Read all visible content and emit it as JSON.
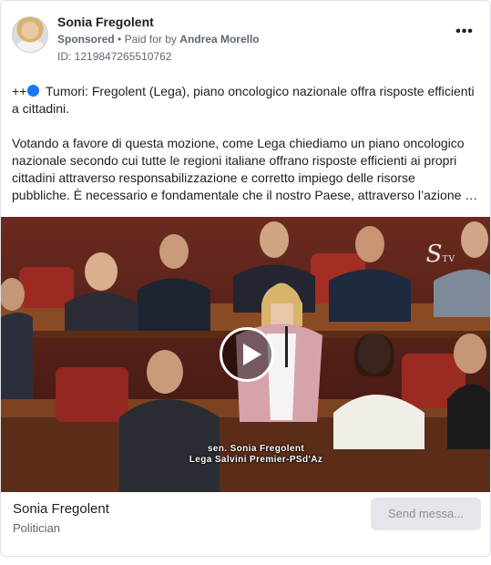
{
  "header": {
    "page_name": "Sonia Fregolent",
    "sponsored_label": "Sponsored",
    "paid_for_prefix": "Paid for by",
    "payer": "Andrea Morello",
    "ad_id": "ID: 1219847265510762",
    "more_icon": "ellipsis-icon"
  },
  "post": {
    "line1_prefix": "++",
    "line1_text": "Tumori: Fregolent (Lega), piano oncologico nazionale offra risposte efficienti a cittadini.",
    "paragraph2_lines": [
      "Votando a favore di questa mozione, come Lega chiediamo un piano oncologico",
      "nazionale secondo cui tutte le regioni italiane offrano risposte efficienti ai propri",
      "cittadini attraverso responsabilizzazione e corretto impiego delle risorse",
      "pubbliche. È necessario e fondamentale che il nostro Paese, attraverso l’azione di…"
    ]
  },
  "video": {
    "play_icon": "play-icon",
    "logo_text": "S",
    "logo_sub": "TV",
    "caption_line1": "sen. Sonia Fregolent",
    "caption_line2": "Lega Salvini Premier-PSd'Az"
  },
  "footer": {
    "name": "Sonia Fregolent",
    "category": "Politician",
    "button_label": "Send messa..."
  },
  "colors": {
    "accent": "#1877f2",
    "secondary_text": "#606770",
    "button_bg": "#e4e6eb"
  }
}
